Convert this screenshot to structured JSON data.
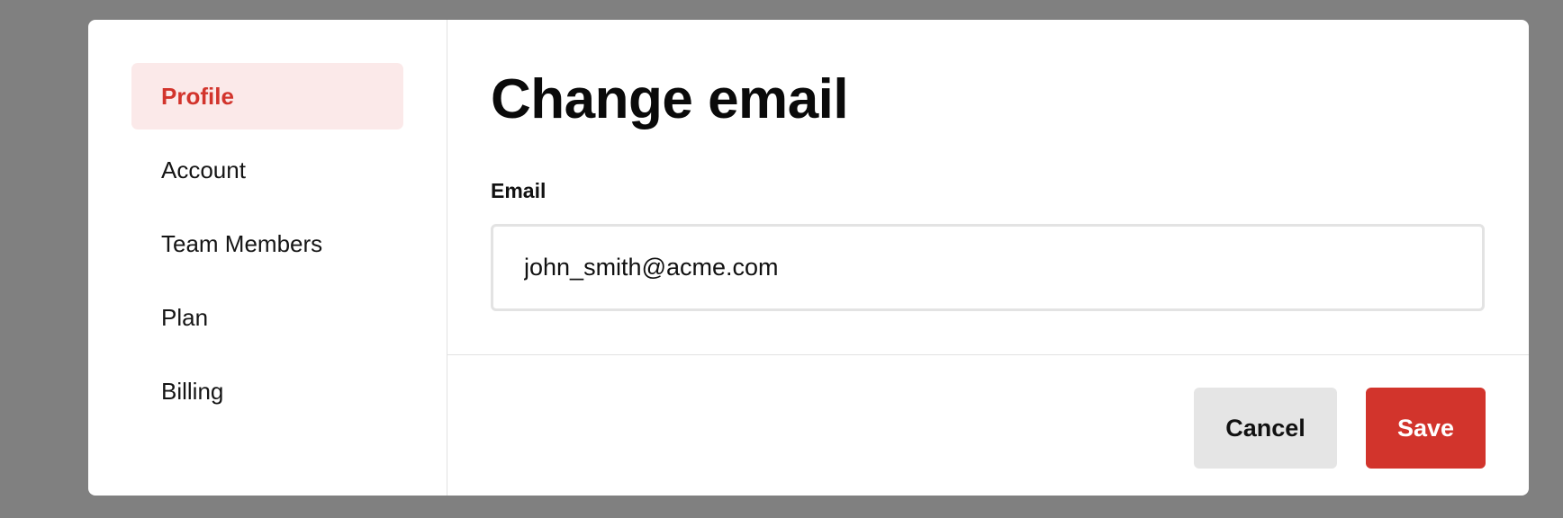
{
  "sidebar": {
    "items": [
      {
        "label": "Profile"
      },
      {
        "label": "Account"
      },
      {
        "label": "Team Members"
      },
      {
        "label": "Plan"
      },
      {
        "label": "Billing"
      }
    ],
    "active": "Profile"
  },
  "main": {
    "title": "Change email",
    "email_label": "Email",
    "email_value": "john_smith@acme.com"
  },
  "footer": {
    "cancel_label": "Cancel",
    "save_label": "Save"
  },
  "colors": {
    "accent": "#d2342c",
    "active_bg": "#fbe9e9",
    "overlay": "#808080"
  }
}
